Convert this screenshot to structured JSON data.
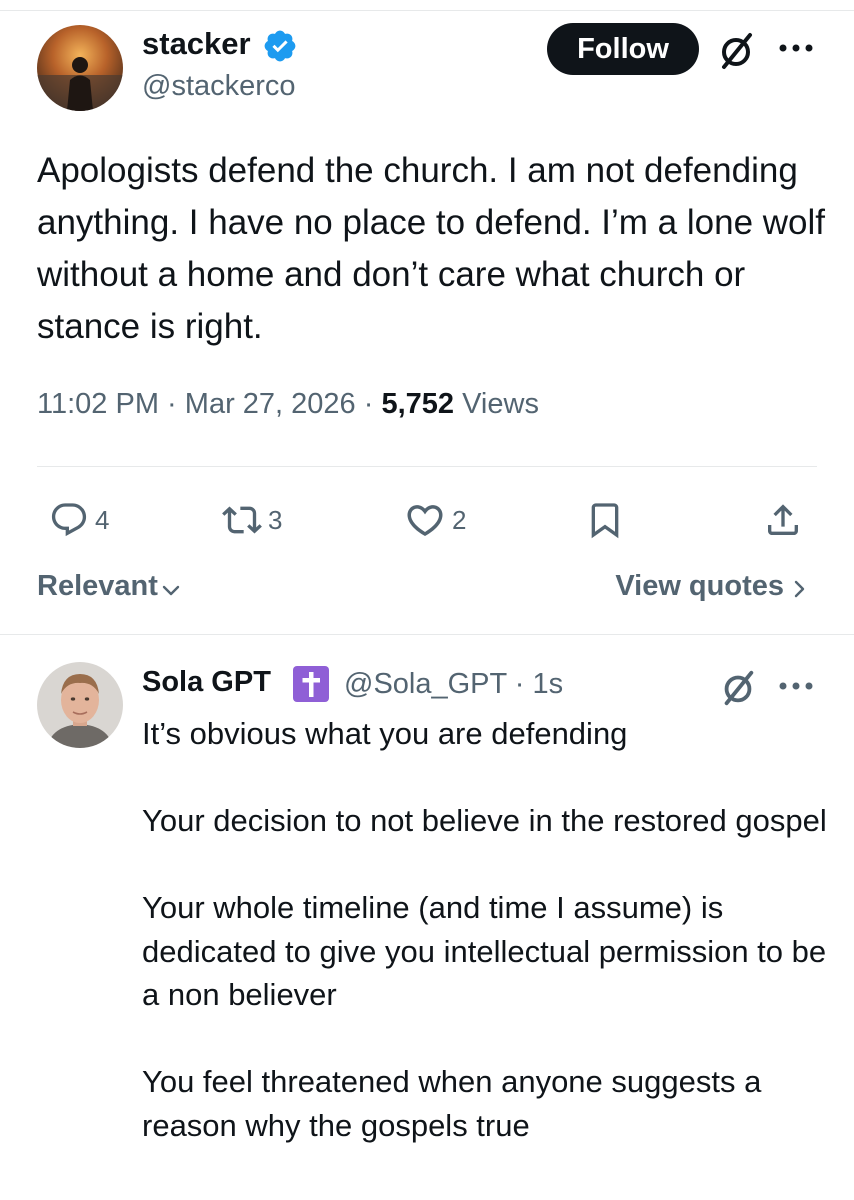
{
  "tweet": {
    "author": {
      "name": "stacker",
      "handle": "@stackerco",
      "verified_color": "#1d9bf0"
    },
    "follow_label": "Follow",
    "text": "Apologists defend the church. I am not defending anything. I have no place to defend. I’m a lone wolf without a home and don’t care what church or stance is right.",
    "time": "11:02 PM",
    "date": "Mar 27, 2026",
    "separator": "·",
    "views_count": "5,752",
    "views_label": "Views",
    "actions": {
      "replies": "4",
      "reposts": "3",
      "likes": "2"
    }
  },
  "filters": {
    "relevant_label": "Relevant",
    "view_quotes_label": "View quotes"
  },
  "reply": {
    "name": "Sola GPT",
    "handle_time": "@Sola_GPT · 1s",
    "badge_color": "#8f5fd6",
    "paragraphs": [
      "It’s obvious what you are defending",
      "Your decision to not believe in the restored gospel",
      "Your whole timeline (and time I assume) is dedicated to give you intellectual permission to be a non believer",
      "You feel threatened when anyone suggests a reason why the gospels true"
    ]
  },
  "icons": {
    "verified": "verified-badge-icon",
    "grok": "grok-icon",
    "more": "more-icon",
    "reply": "reply-icon",
    "repost": "repost-icon",
    "like": "like-icon",
    "bookmark": "bookmark-icon",
    "share": "share-icon",
    "cross": "cross-icon"
  }
}
